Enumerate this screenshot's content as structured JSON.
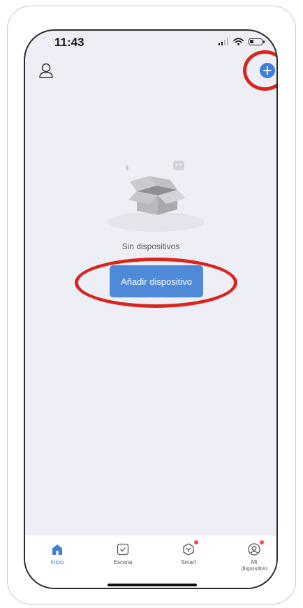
{
  "status_bar": {
    "time": "11:43",
    "battery_level": 0.3
  },
  "header": {
    "profile_icon": "person-icon",
    "add_icon": "plus-icon"
  },
  "empty_state": {
    "illustration": "empty-box-icon",
    "message": "Sin dispositivos",
    "button_label": "Añadir dispositivo"
  },
  "tabs": [
    {
      "label": "Inicio",
      "icon": "home-icon",
      "active": true
    },
    {
      "label": "Escena",
      "icon": "checkbox-icon",
      "active": false
    },
    {
      "label": "Smart",
      "icon": "smart-icon",
      "active": false
    },
    {
      "label": "Mi\ndispositivo",
      "icon": "profile-icon",
      "active": false
    }
  ],
  "colors": {
    "accent": "#3f7fdc",
    "button": "#4f8ad8",
    "highlight": "#d8261e",
    "background": "#eeeff6"
  }
}
